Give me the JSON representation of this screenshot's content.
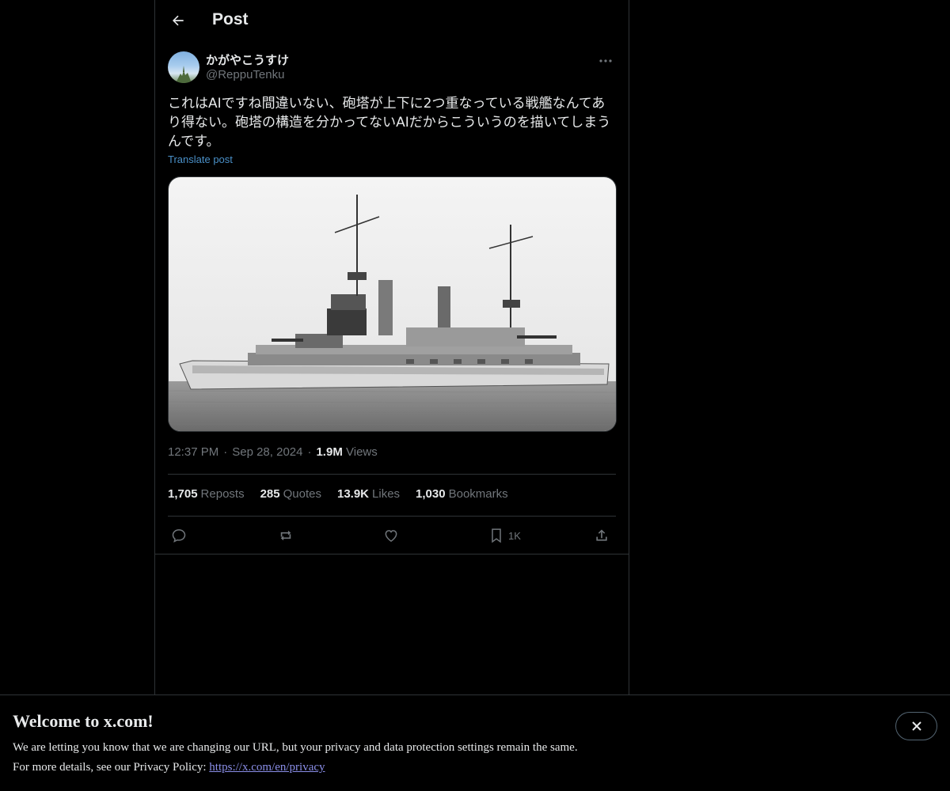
{
  "header": {
    "title": "Post",
    "back_icon": "arrow-left-icon"
  },
  "author": {
    "display_name": "かがやこうすけ",
    "handle": "@ReppuTenku"
  },
  "post": {
    "text": "これはAIですね間違いない、砲塔が上下に2つ重なっている戦艦なんてあり得ない。砲塔の構造を分かってないAIだからこういうのを描いてしまうんです。",
    "translate_label": "Translate post",
    "time": "12:37 PM",
    "date": "Sep 28, 2024",
    "views_count": "1.9M",
    "views_label": "Views"
  },
  "stats": {
    "reposts_count": "1,705",
    "reposts_label": "Reposts",
    "quotes_count": "285",
    "quotes_label": "Quotes",
    "likes_count": "13.9K",
    "likes_label": "Likes",
    "bookmarks_count": "1,030",
    "bookmarks_label": "Bookmarks"
  },
  "actions": {
    "reply_icon": "reply-icon",
    "repost_icon": "repost-icon",
    "like_icon": "heart-icon",
    "bookmark_icon": "bookmark-icon",
    "bookmark_count": "1K",
    "share_icon": "share-icon"
  },
  "banner": {
    "title": "Welcome to x.com!",
    "line1": "We are letting you know that we are changing our URL, but your privacy and data protection settings remain the same.",
    "line2_prefix": "For more details, see our Privacy Policy: ",
    "link": "https://x.com/en/privacy",
    "close_icon": "close-icon"
  },
  "colors": {
    "background": "#000000",
    "text": "#e7e9ea",
    "muted": "#71767b",
    "border": "#2f3336",
    "link": "#4a90c8"
  }
}
